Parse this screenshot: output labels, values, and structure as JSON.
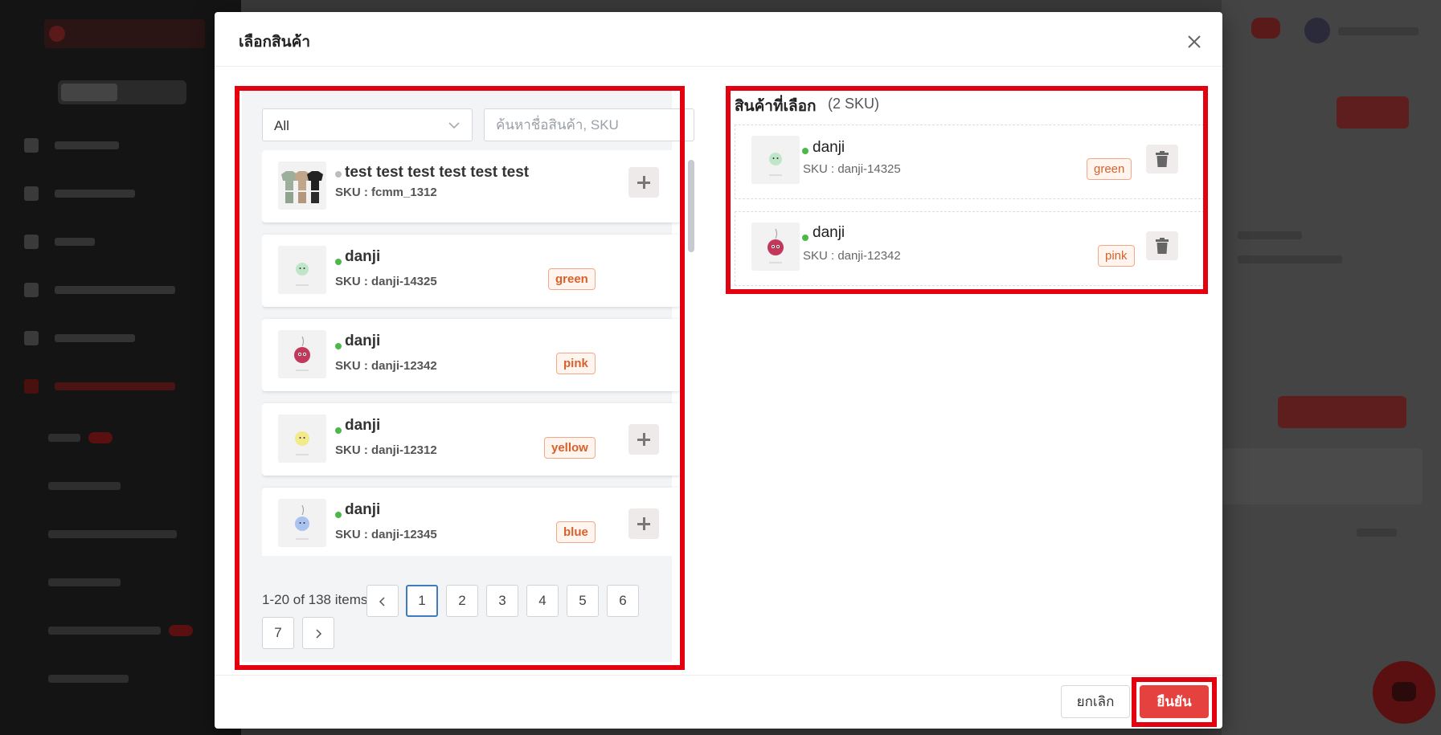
{
  "modal": {
    "title": "เลือกสินค้า"
  },
  "filter": {
    "selected": "All",
    "search_placeholder": "ค้นหาชื่อสินค้า, SKU"
  },
  "products": [
    {
      "name": "test test test test test test",
      "sku": "SKU : fcmm_1312",
      "variant": "",
      "status": "inactive",
      "addable": true
    },
    {
      "name": "danji",
      "sku": "SKU : danji-14325",
      "variant": "green",
      "status": "active",
      "addable": false
    },
    {
      "name": "danji",
      "sku": "SKU : danji-12342",
      "variant": "pink",
      "status": "active",
      "addable": false
    },
    {
      "name": "danji",
      "sku": "SKU : danji-12312",
      "variant": "yellow",
      "status": "active",
      "addable": true
    },
    {
      "name": "danji",
      "sku": "SKU : danji-12345",
      "variant": "blue",
      "status": "active",
      "addable": true
    }
  ],
  "pagination": {
    "range_text": "1-20 of 138 items",
    "pages": [
      "1",
      "2",
      "3",
      "4",
      "5",
      "6",
      "7"
    ],
    "current": "1"
  },
  "selected_panel": {
    "title": "สินค้าที่เลือก",
    "count_text": "(2 SKU)",
    "items": [
      {
        "name": "danji",
        "sku": "SKU : danji-14325",
        "variant": "green"
      },
      {
        "name": "danji",
        "sku": "SKU : danji-12342",
        "variant": "pink"
      }
    ]
  },
  "footer": {
    "cancel_label": "ยกเลิก",
    "confirm_label": "ยืนยัน"
  },
  "colors": {
    "accent": "#e5413e",
    "highlight": "#e3000f",
    "status_active": "#4cb848",
    "status_inactive": "#bdbdbd",
    "tag_text": "#d8612a",
    "pagination_active": "#3f7bc0"
  }
}
